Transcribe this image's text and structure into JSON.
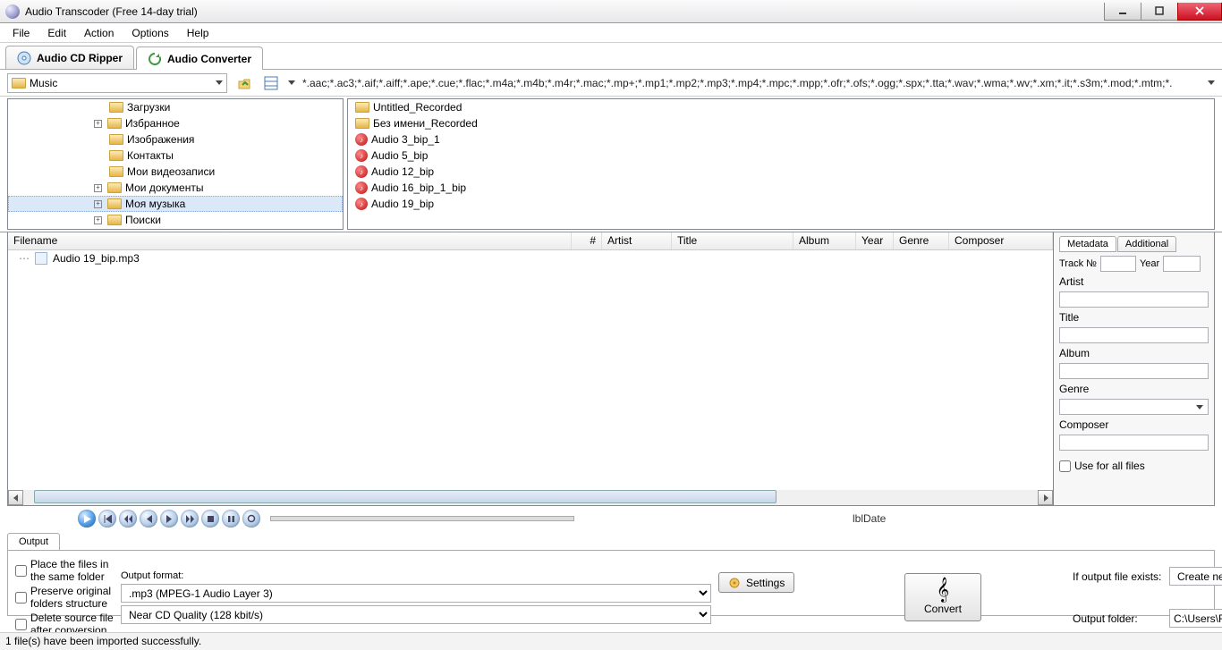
{
  "window": {
    "title": "Audio Transcoder (Free 14-day trial)"
  },
  "menu": {
    "file": "File",
    "edit": "Edit",
    "action": "Action",
    "options": "Options",
    "help": "Help"
  },
  "maintabs": {
    "ripper": "Audio CD Ripper",
    "converter": "Audio Converter"
  },
  "pathbar": {
    "folder": "Music",
    "filters": "*.aac;*.ac3;*.aif;*.aiff;*.ape;*.cue;*.flac;*.m4a;*.m4b;*.m4r;*.mac;*.mp+;*.mp1;*.mp2;*.mp3;*.mp4;*.mpc;*.mpp;*.ofr;*.ofs;*.ogg;*.spx;*.tta;*.wav;*.wma;*.wv;*.xm;*.it;*.s3m;*.mod;*.mtm;*."
  },
  "tree": {
    "items": [
      {
        "label": "Загрузки",
        "exp": ""
      },
      {
        "label": "Избранное",
        "exp": "▸"
      },
      {
        "label": "Изображения",
        "exp": ""
      },
      {
        "label": "Контакты",
        "exp": ""
      },
      {
        "label": "Мои видеозаписи",
        "exp": ""
      },
      {
        "label": "Мои документы",
        "exp": "▸"
      },
      {
        "label": "Моя музыка",
        "exp": "▸",
        "sel": true
      },
      {
        "label": "Поиски",
        "exp": "▸"
      }
    ]
  },
  "files": {
    "items": [
      {
        "t": "f",
        "label": "Untitled_Recorded"
      },
      {
        "t": "f",
        "label": "Без имени_Recorded"
      },
      {
        "t": "m",
        "label": "Audio 3_bip_1"
      },
      {
        "t": "m",
        "label": "Audio 5_bip"
      },
      {
        "t": "m",
        "label": "Audio 12_bip"
      },
      {
        "t": "m",
        "label": "Audio 16_bip_1_bip"
      },
      {
        "t": "m",
        "label": "Audio 19_bip"
      }
    ]
  },
  "queue": {
    "headers": {
      "filename": "Filename",
      "num": "#",
      "artist": "Artist",
      "title": "Title",
      "album": "Album",
      "year": "Year",
      "genre": "Genre",
      "composer": "Composer"
    },
    "rows": [
      {
        "filename": "Audio 19_bip.mp3"
      }
    ]
  },
  "meta": {
    "tabs": {
      "metadata": "Metadata",
      "additional": "Additional"
    },
    "labels": {
      "trackno": "Track №",
      "year": "Year",
      "artist": "Artist",
      "title": "Title",
      "album": "Album",
      "genre": "Genre",
      "composer": "Composer",
      "useall": "Use for all files"
    }
  },
  "player": {
    "lbldate": "lblDate"
  },
  "output": {
    "tab": "Output",
    "exists_label": "If output file exists:",
    "exists_value": "Create new file",
    "folder_label": "Output folder:",
    "folder_value": "C:\\Users\\ReverBeat\\Music",
    "chk_same": "Place the files in the same folder",
    "chk_preserve": "Preserve original folders structure",
    "chk_delete": "Delete source file after conversion",
    "format_label": "Output format:",
    "format_value": ".mp3 (MPEG-1 Audio Layer 3)",
    "quality_value": "Near CD Quality (128 kbit/s)",
    "settings": "Settings",
    "convert": "Convert"
  },
  "status": "1 file(s) have been imported successfully."
}
